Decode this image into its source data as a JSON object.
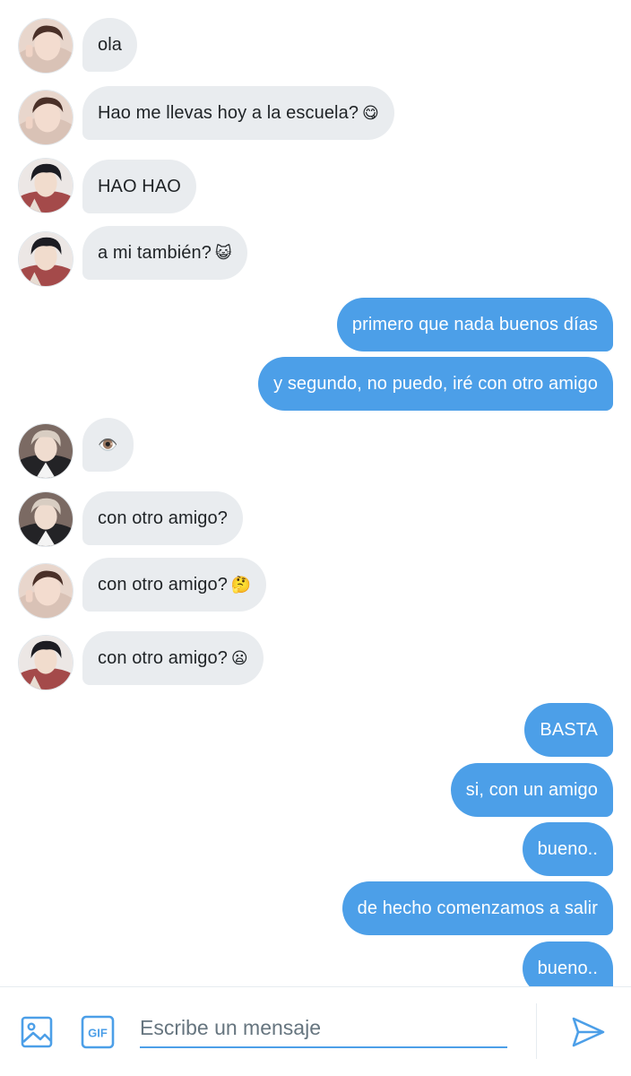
{
  "colors": {
    "accent": "#4c9fe8",
    "incoming_bubble": "#e9ecef",
    "incoming_text": "#1f2326",
    "outgoing_text": "#ffffff"
  },
  "messages": [
    {
      "side": "in",
      "avatar": "friend-1",
      "text": "ola",
      "emoji": ""
    },
    {
      "side": "in",
      "avatar": "friend-1",
      "text": "Hao me llevas hoy a la escuela?",
      "emoji": "😋"
    },
    {
      "side": "in",
      "avatar": "friend-2",
      "text": "HAO HAO",
      "emoji": ""
    },
    {
      "side": "in",
      "avatar": "friend-2",
      "text": "a mi también?",
      "emoji": "😺"
    },
    {
      "side": "out",
      "text": "primero que nada buenos días"
    },
    {
      "side": "out",
      "text": "y segundo, no puedo, iré con otro amigo"
    },
    {
      "side": "in",
      "avatar": "friend-3",
      "text": "",
      "emoji": "👁️"
    },
    {
      "side": "in",
      "avatar": "friend-3",
      "text": "con otro amigo?",
      "emoji": ""
    },
    {
      "side": "in",
      "avatar": "friend-1",
      "text": "con otro amigo?",
      "emoji": "🤔"
    },
    {
      "side": "in",
      "avatar": "friend-2",
      "text": "con otro amigo?",
      "emoji": "😦"
    },
    {
      "side": "out",
      "text": "BASTA"
    },
    {
      "side": "out",
      "text": "si, con un amigo"
    },
    {
      "side": "out",
      "text": "bueno.."
    },
    {
      "side": "out",
      "text": "de hecho comenzamos a salir"
    },
    {
      "side": "out",
      "text": "bueno.."
    }
  ],
  "composer": {
    "placeholder": "Escribe un mensaje",
    "media_icon": "image-icon",
    "gif_icon": "gif-icon",
    "gif_label": "GIF",
    "send_icon": "send-icon"
  }
}
